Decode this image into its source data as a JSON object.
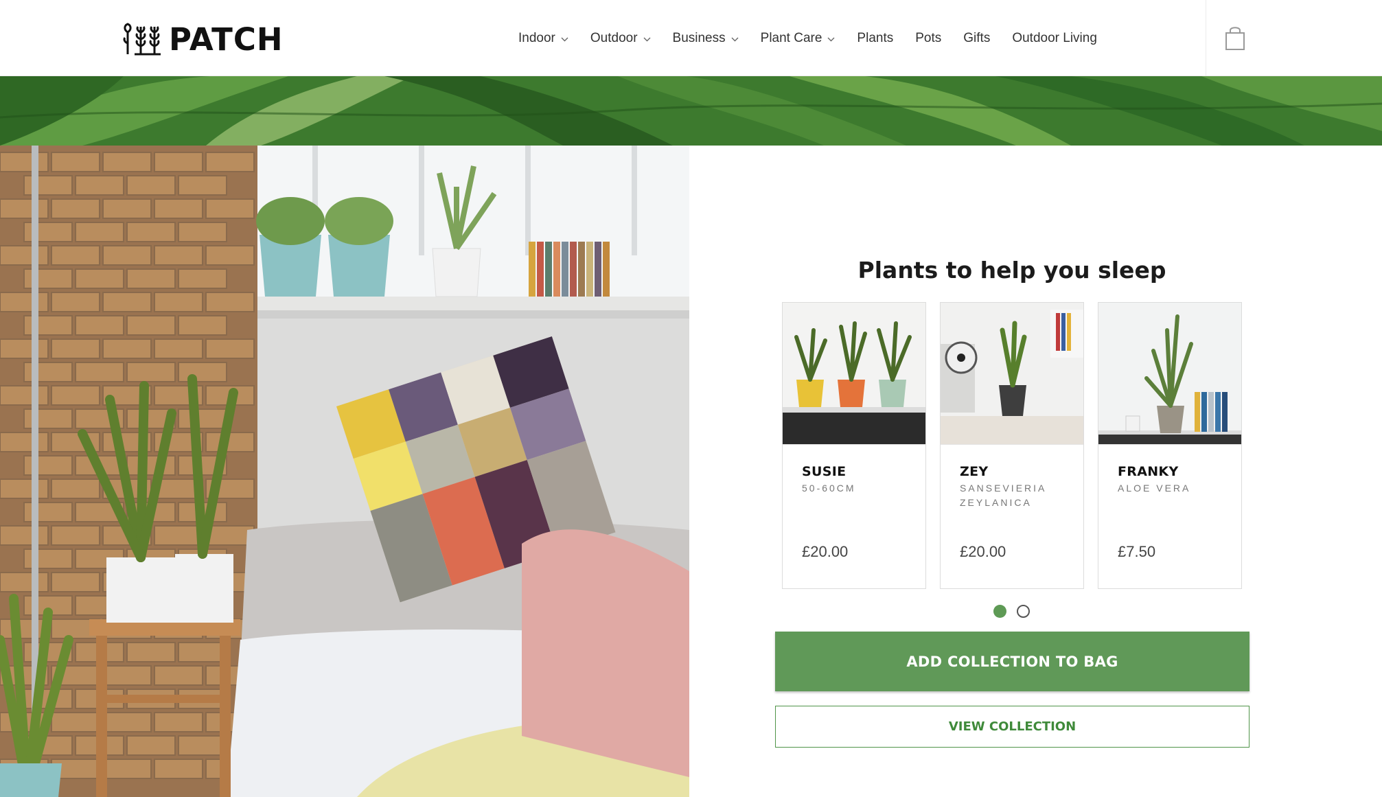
{
  "brand": {
    "name": "PATCH",
    "logo_icon": "plant-trio-logo-icon"
  },
  "nav": {
    "items": [
      {
        "label": "Indoor",
        "dropdown": true
      },
      {
        "label": "Outdoor",
        "dropdown": true
      },
      {
        "label": "Business",
        "dropdown": true
      },
      {
        "label": "Plant Care",
        "dropdown": true
      },
      {
        "label": "Plants",
        "dropdown": false
      },
      {
        "label": "Pots",
        "dropdown": false
      },
      {
        "label": "Gifts",
        "dropdown": false
      },
      {
        "label": "Outdoor Living",
        "dropdown": false
      }
    ],
    "bag_icon": "shopping-bag-icon"
  },
  "collection": {
    "title": "Plants to help you sleep",
    "products": [
      {
        "name": "SUSIE",
        "subtitle": "50-60CM",
        "price": "£20.00"
      },
      {
        "name": "ZEY",
        "subtitle": "SANSEVIERIA ZEYLANICA",
        "price": "£20.00"
      },
      {
        "name": "FRANKY",
        "subtitle": "ALOE VERA",
        "price": "£7.50"
      }
    ],
    "carousel": {
      "pages": 2,
      "active": 1
    },
    "add_button": "ADD COLLECTION TO BAG",
    "view_button": "VIEW COLLECTION"
  },
  "colors": {
    "accent_green": "#609958",
    "text_dark": "#1b1b1b",
    "banner_green": "#3f7d30"
  }
}
